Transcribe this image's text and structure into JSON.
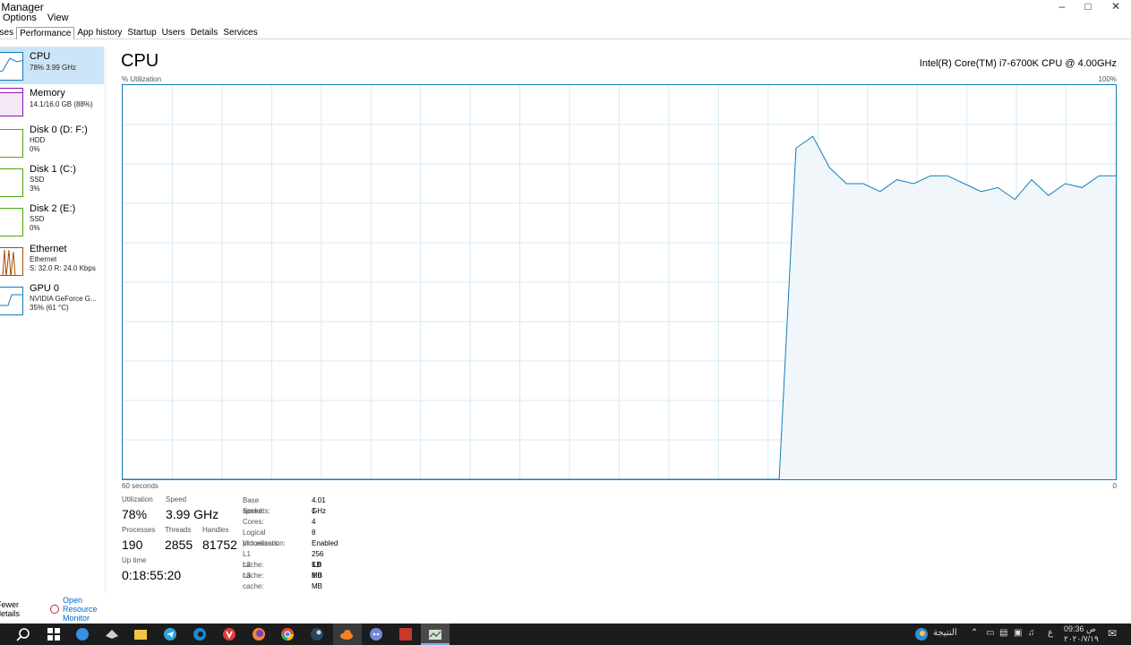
{
  "window": {
    "title": "sk Manager"
  },
  "menu": [
    "Options",
    "View"
  ],
  "tabs": [
    "esses",
    "Performance",
    "App history",
    "Startup",
    "Users",
    "Details",
    "Services"
  ],
  "sidebar": [
    {
      "name": "CPU",
      "l1": "78% 3.99 GHz",
      "l2": "",
      "l3": ""
    },
    {
      "name": "Memory",
      "l1": "14.1/16.0 GB (88%)",
      "l2": "",
      "l3": ""
    },
    {
      "name": "Disk 0 (D: F:)",
      "l1": "HDD",
      "l2": "0%",
      "l3": ""
    },
    {
      "name": "Disk 1 (C:)",
      "l1": "SSD",
      "l2": "3%",
      "l3": ""
    },
    {
      "name": "Disk 2 (E:)",
      "l1": "SSD",
      "l2": "0%",
      "l3": ""
    },
    {
      "name": "Ethernet",
      "l1": "Ethernet",
      "l2": "S: 32.0  R: 24.0 Kbps",
      "l3": ""
    },
    {
      "name": "GPU 0",
      "l1": "NVIDIA GeForce G...",
      "l2": "35% (61 °C)",
      "l3": ""
    }
  ],
  "main": {
    "title": "CPU",
    "model": "Intel(R) Core(TM) i7-6700K CPU @ 4.00GHz",
    "util_label": "% Utilization",
    "max_label": "100%",
    "time_label": "60 seconds",
    "min_label": "0"
  },
  "chart_data": {
    "type": "area",
    "ylabel": "% Utilization",
    "ylim": [
      0,
      100
    ],
    "x_range_seconds": [
      60,
      0
    ],
    "values": [
      0,
      0,
      0,
      0,
      0,
      0,
      0,
      0,
      0,
      0,
      0,
      0,
      0,
      0,
      0,
      0,
      0,
      0,
      0,
      0,
      0,
      0,
      0,
      0,
      0,
      0,
      0,
      0,
      0,
      0,
      0,
      0,
      0,
      0,
      0,
      0,
      0,
      0,
      0,
      0,
      84,
      87,
      79,
      75,
      75,
      73,
      76,
      75,
      77,
      77,
      75,
      73,
      74,
      71,
      76,
      72,
      75,
      74,
      77,
      77
    ]
  },
  "stats": {
    "utilization_label": "Utilization",
    "utilization": "78%",
    "speed_label": "Speed",
    "speed": "3.99 GHz",
    "processes_label": "Processes",
    "processes": "190",
    "threads_label": "Threads",
    "threads": "2855",
    "handles_label": "Handles",
    "handles": "81752",
    "uptime_label": "Up time",
    "uptime": "0:18:55:20"
  },
  "specs": [
    {
      "k": "Base speed:",
      "v": "4.01 GHz"
    },
    {
      "k": "Sockets:",
      "v": "1"
    },
    {
      "k": "Cores:",
      "v": "4"
    },
    {
      "k": "Logical processors:",
      "v": "8"
    },
    {
      "k": "Virtualization:",
      "v": "Enabled"
    },
    {
      "k": "L1 cache:",
      "v": "256 KB"
    },
    {
      "k": "L2 cache:",
      "v": "1.0 MB"
    },
    {
      "k": "L3 cache:",
      "v": "8.0 MB"
    }
  ],
  "bottom": {
    "fewer": "Fewer details",
    "resmon": "Open Resource Monitor"
  },
  "taskbar": {
    "weather_text": "النتيجة",
    "lang": "ع",
    "time": "09:36 ص",
    "date": "٢٠٢٠/٧/١٩"
  },
  "colors": {
    "accent": "#117dbb",
    "fill": "#f1f6fa",
    "selected": "#cce4f7",
    "taskbar": "#1c1c1c"
  }
}
